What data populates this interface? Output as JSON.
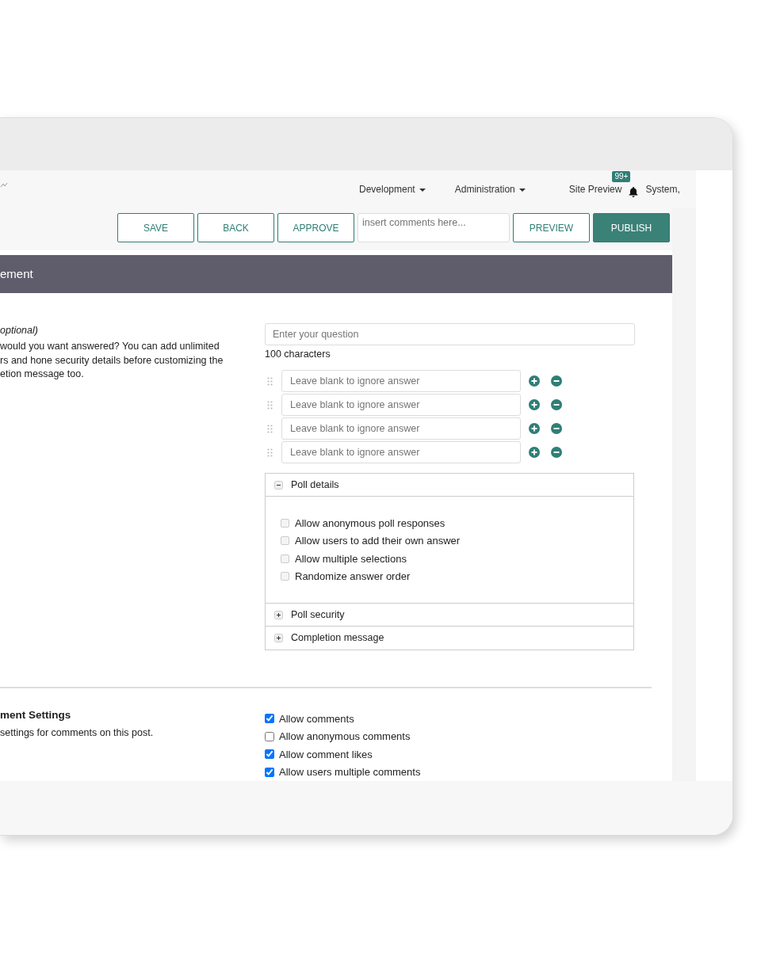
{
  "nav": {
    "menus": [
      {
        "label": "Development"
      },
      {
        "label": "Administration"
      }
    ],
    "site_preview": "Site Preview",
    "notification_badge": "99+",
    "user": "System,"
  },
  "toolbar": [
    {
      "kind": "outline",
      "label": "SAVE"
    },
    {
      "kind": "outline",
      "label": "BACK"
    },
    {
      "kind": "outline",
      "label": "APPROVE"
    },
    {
      "kind": "field",
      "placeholder": "insert comments here..."
    },
    {
      "kind": "outline",
      "label": "PREVIEW"
    },
    {
      "kind": "solid",
      "label": "PUBLISH"
    }
  ],
  "section_title": "ement",
  "question": {
    "label": "optional)",
    "help_lines": [
      "would you want answered? You can add unlimited",
      "rs and hone security details before customizing the",
      "etion message too."
    ],
    "placeholder": "Enter your question",
    "char_count": "100 characters"
  },
  "answers": [
    {
      "placeholder": "Leave blank to ignore answer"
    },
    {
      "placeholder": "Leave blank to ignore answer"
    },
    {
      "placeholder": "Leave blank to ignore answer"
    },
    {
      "placeholder": "Leave blank to ignore answer"
    }
  ],
  "panels": [
    {
      "title": "Poll details",
      "expanded": true,
      "options": [
        {
          "label": "Allow anonymous poll responses",
          "checked": false
        },
        {
          "label": "Allow users to add their own answer",
          "checked": false
        },
        {
          "label": "Allow multiple selections",
          "checked": false
        },
        {
          "label": "Randomize answer order",
          "checked": false
        }
      ]
    },
    {
      "title": "Poll security",
      "expanded": false
    },
    {
      "title": "Completion message",
      "expanded": false
    }
  ],
  "comment_settings": {
    "title": "ment Settings",
    "help": "settings for comments on this post.",
    "options": [
      {
        "label": "Allow comments",
        "checked": true
      },
      {
        "label": "Allow anonymous comments",
        "checked": false
      },
      {
        "label": "Allow comment likes",
        "checked": true
      },
      {
        "label": "Allow users multiple comments",
        "checked": true
      }
    ]
  }
}
